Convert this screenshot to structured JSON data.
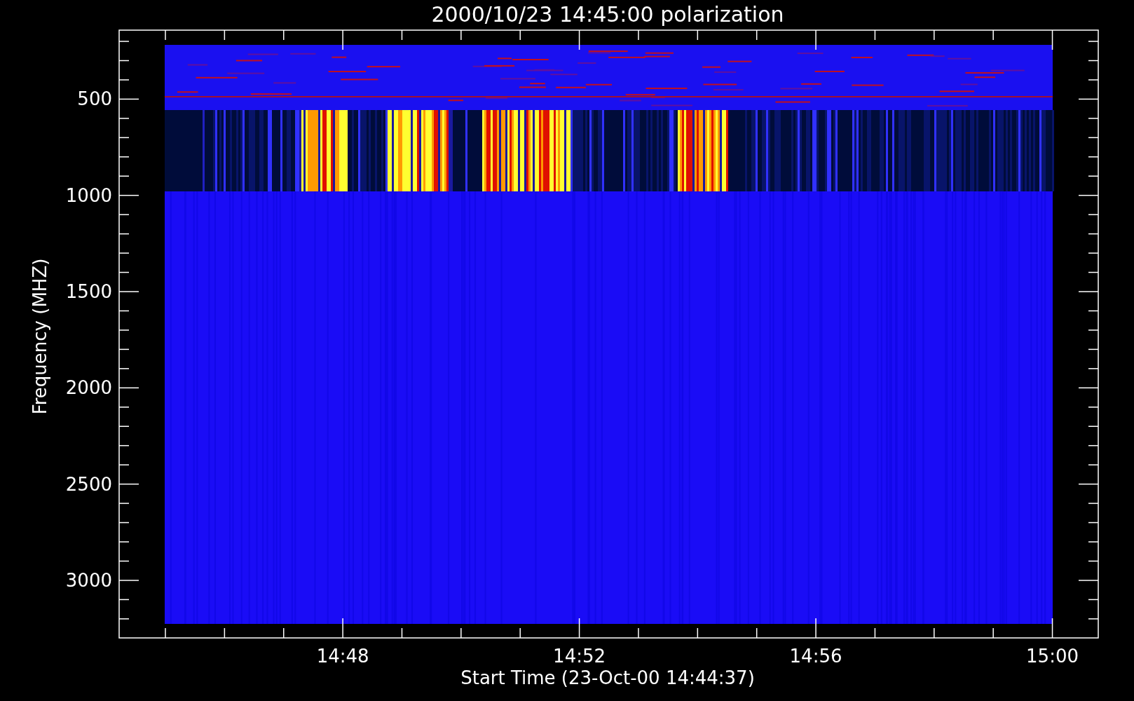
{
  "plot": {
    "title": "2000/10/23 14:45:00 polarization",
    "ylabel": "Frequency (MHZ)",
    "xlabel": "Start Time (23-Oct-00 14:44:37)",
    "yticks": [
      "500",
      "1000",
      "1500",
      "2000",
      "2500",
      "3000"
    ],
    "xticks": [
      "14:48",
      "14:52",
      "14:56",
      "15:00"
    ]
  }
}
